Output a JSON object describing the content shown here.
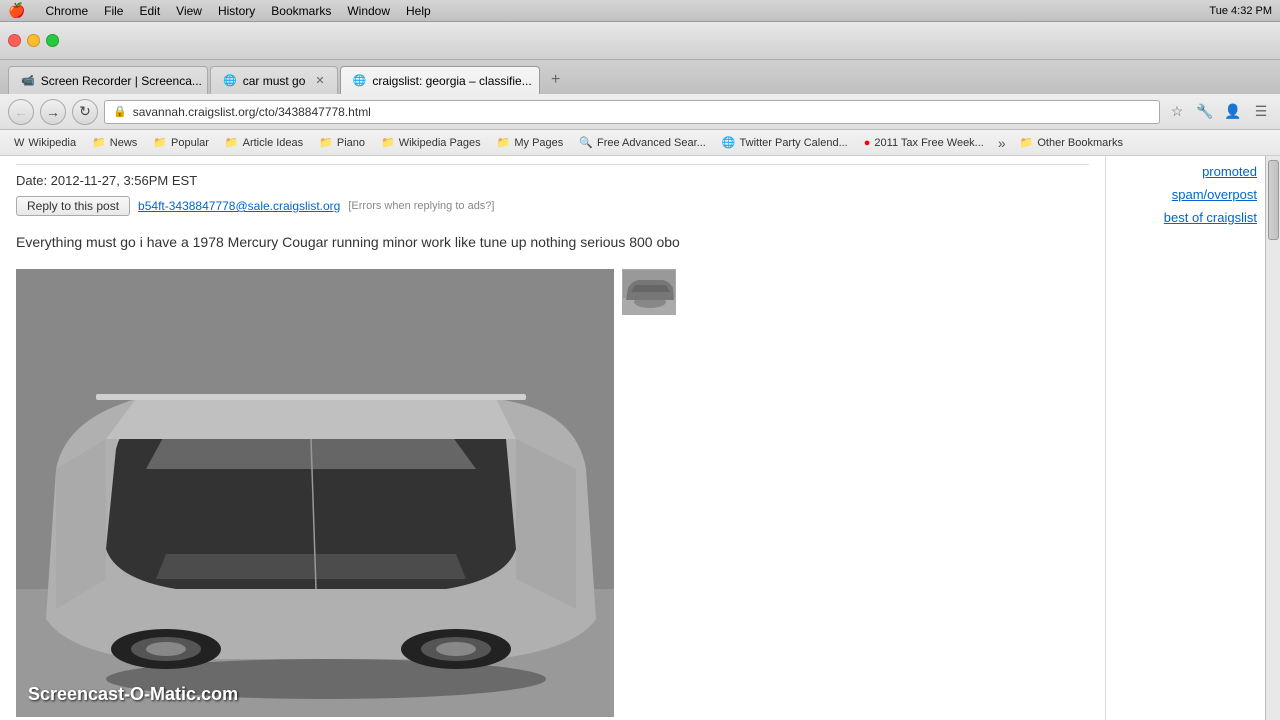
{
  "mac_menubar": {
    "apple": "🍎",
    "items": [
      "Chrome",
      "File",
      "Edit",
      "View",
      "History",
      "Bookmarks",
      "Window",
      "Help"
    ],
    "right": "Tue 4:32 PM"
  },
  "chrome": {
    "tabs": [
      {
        "id": "tab1",
        "label": "Screen Recorder | Screenca...",
        "favicon": "📹",
        "active": false
      },
      {
        "id": "tab2",
        "label": "car must go",
        "favicon": "🌐",
        "active": false
      },
      {
        "id": "tab3",
        "label": "craigslist: georgia – classifie...",
        "favicon": "🌐",
        "active": true
      }
    ]
  },
  "nav": {
    "address": "savannah.craigslist.org/cto/3438847778.html"
  },
  "bookmarks": [
    {
      "label": "Wikipedia",
      "icon": "W"
    },
    {
      "label": "News",
      "icon": "📰"
    },
    {
      "label": "Popular",
      "icon": "📁"
    },
    {
      "label": "Article Ideas",
      "icon": "📁"
    },
    {
      "label": "Piano",
      "icon": "📁"
    },
    {
      "label": "Wikipedia Pages",
      "icon": "📁"
    },
    {
      "label": "My Pages",
      "icon": "📁"
    },
    {
      "label": "Free Advanced Sear...",
      "icon": "🔍"
    },
    {
      "label": "Twitter Party Calend...",
      "icon": "🌐"
    },
    {
      "label": "2011 Tax Free Week...",
      "icon": "🔴"
    }
  ],
  "sidebar": {
    "promoted_label": "promoted",
    "spam_label": "spam/overpost",
    "best_label": "best of craigslist"
  },
  "post": {
    "date": "Date: 2012-11-27, 3:56PM EST",
    "reply_button": "Reply to this post",
    "email": "b54ft-3438847778@sale.craigslist.org",
    "errors_text": "[Errors when replying to ads?]",
    "body": "Everything must go i have a 1978 Mercury Cougar running minor work like tune up nothing serious 800 obo"
  },
  "watermark": "Screencast-O-Matic.com",
  "other_bookmarks": "Other Bookmarks"
}
